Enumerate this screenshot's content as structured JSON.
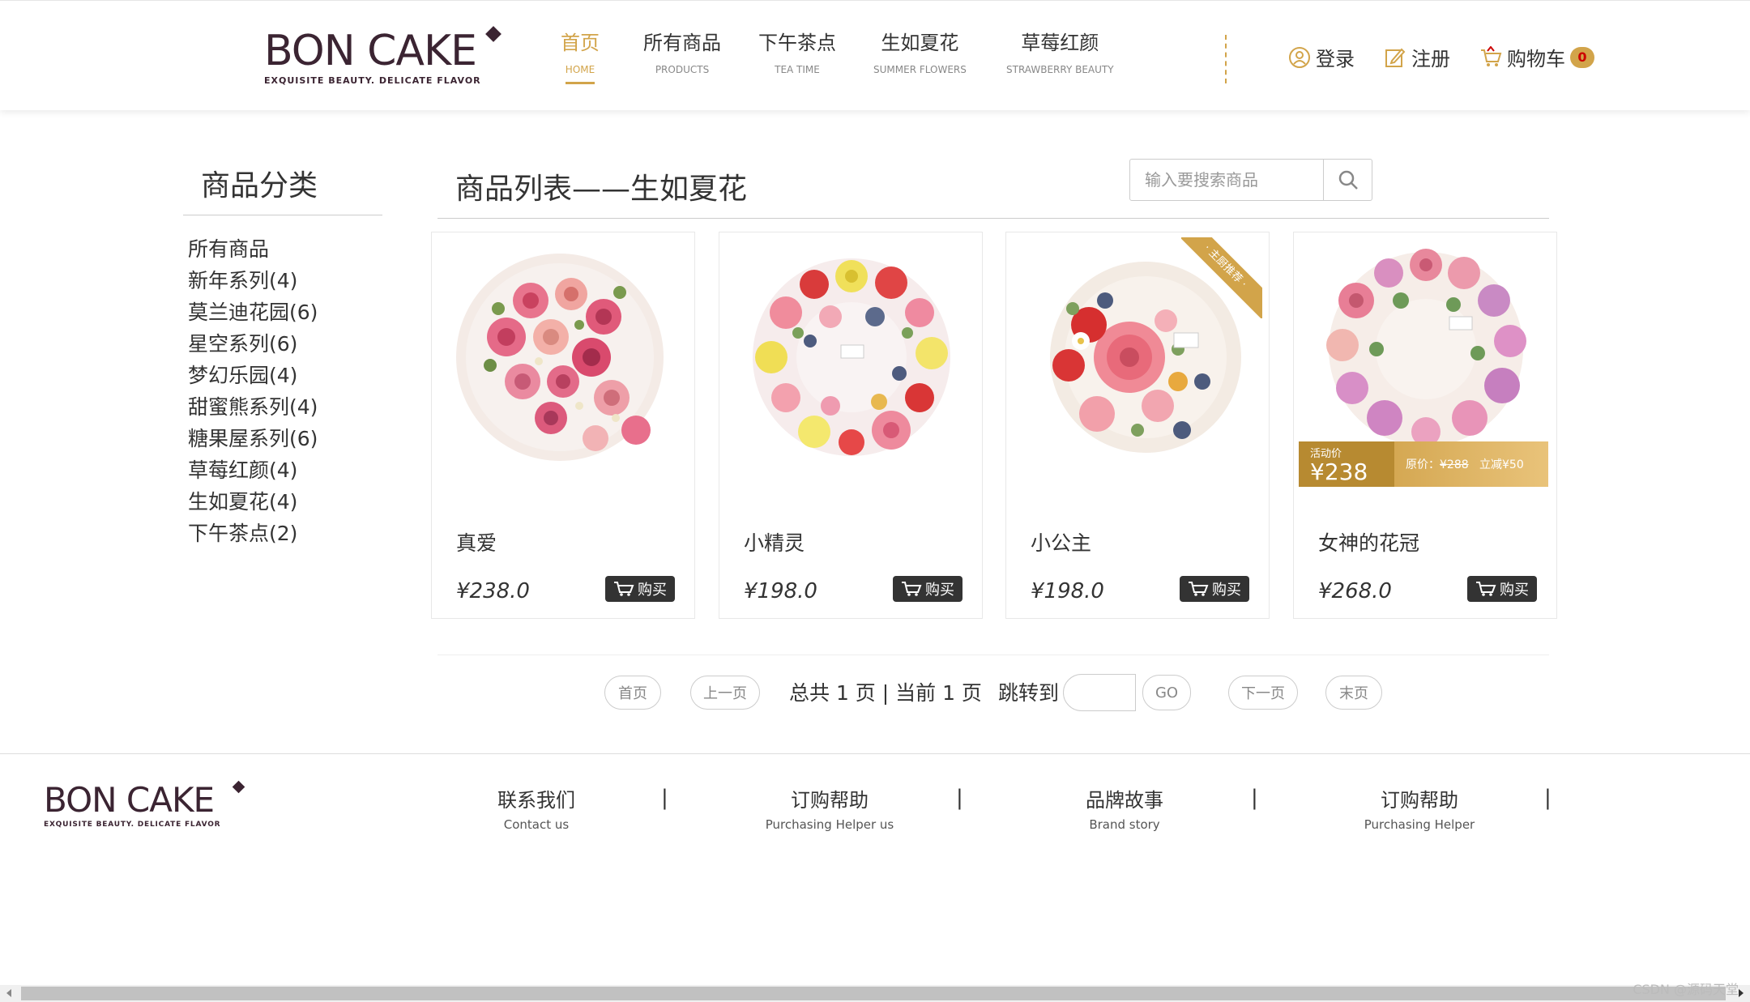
{
  "brand": {
    "name": "BON CAKE",
    "tagline": "EXQUISITE BEAUTY. DELICATE FLAVOR",
    "color": "#3b2432"
  },
  "accent_color": "#d2a44a",
  "nav": [
    {
      "zh": "首页",
      "en": "HOME",
      "active": true
    },
    {
      "zh": "所有商品",
      "en": "PRODUCTS",
      "active": false
    },
    {
      "zh": "下午茶点",
      "en": "TEA TIME",
      "active": false
    },
    {
      "zh": "生如夏花",
      "en": "SUMMER FLOWERS",
      "active": false
    },
    {
      "zh": "草莓红颜",
      "en": "STRAWBERRY BEAUTY",
      "active": false
    }
  ],
  "user": {
    "login": "登录",
    "register": "注册",
    "cart": "购物车",
    "cart_count": "0"
  },
  "sidebar": {
    "title": "商品分类",
    "categories": [
      "所有商品",
      "新年系列(4)",
      "莫兰迪花园(6)",
      "星空系列(6)",
      "梦幻乐园(4)",
      "甜蜜熊系列(4)",
      "糖果屋系列(6)",
      "草莓红颜(4)",
      "生如夏花(4)",
      "下午茶点(2)"
    ]
  },
  "main": {
    "title": "商品列表——生如夏花",
    "search_placeholder": "输入要搜索商品"
  },
  "products": [
    {
      "name": "真爱",
      "price": "¥238.0",
      "buy": "购买",
      "ribbon": "",
      "promo": null
    },
    {
      "name": "小精灵",
      "price": "¥198.0",
      "buy": "购买",
      "ribbon": "",
      "promo": null
    },
    {
      "name": "小公主",
      "price": "¥198.0",
      "buy": "购买",
      "ribbon": "· 主厨推荐 ·",
      "promo": null
    },
    {
      "name": "女神的花冠",
      "price": "¥268.0",
      "buy": "购买",
      "ribbon": "",
      "promo": {
        "label": "活动价",
        "price": "¥238",
        "orig_label": "原价：",
        "orig": "¥288",
        "off": "立减¥50"
      }
    }
  ],
  "pagination": {
    "first": "首页",
    "prev": "上一页",
    "summary": "总共 1 页 | 当前 1 页",
    "jump_label": "跳转到",
    "go": "GO",
    "next": "下一页",
    "last": "末页"
  },
  "footer": {
    "columns": [
      {
        "zh": "联系我们",
        "en": "Contact us"
      },
      {
        "zh": "订购帮助",
        "en": "Purchasing Helper us"
      },
      {
        "zh": "品牌故事",
        "en": "Brand story"
      },
      {
        "zh": "订购帮助",
        "en": "Purchasing Helper"
      }
    ],
    "separator": "|"
  },
  "watermark": "CSDN @源码天堂"
}
